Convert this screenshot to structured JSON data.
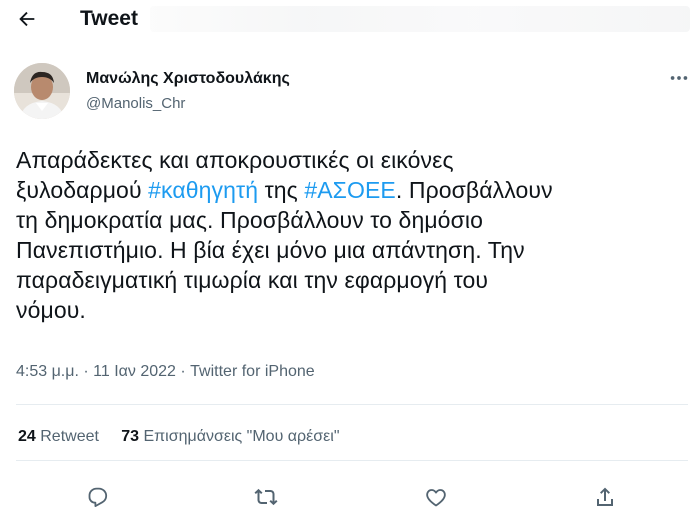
{
  "header": {
    "title": "Tweet",
    "back_icon": "arrow-left-icon"
  },
  "author": {
    "display_name": "Μανώλης Χριστοδουλάκης",
    "handle": "@Manolis_Chr"
  },
  "tweet": {
    "lines": [
      [
        {
          "text": "Απαράδεκτες και αποκρουστικές οι εικόνες"
        }
      ],
      [
        {
          "text": "ξυλοδαρμού "
        },
        {
          "text": "#καθηγητή",
          "hashtag": true
        },
        {
          "text": " της "
        },
        {
          "text": "#ΑΣΟΕΕ",
          "hashtag": true
        },
        {
          "text": ". Προσβάλλουν"
        }
      ],
      [
        {
          "text": "τη δημοκρατία μας. Προσβάλλουν το δημόσιο"
        }
      ],
      [
        {
          "text": "Πανεπιστήμιο. Η βία έχει μόνο μια απάντηση. Την"
        }
      ],
      [
        {
          "text": "παραδειγματική τιμωρία και την εφαρμογή του"
        }
      ],
      [
        {
          "text": "νόμου."
        }
      ]
    ],
    "time": "4:53 μ.μ.",
    "date": "11 Ιαν 2022",
    "source": "Twitter for iPhone",
    "separator": " · "
  },
  "stats": {
    "retweets_count": "24",
    "retweets_label": "Retweet",
    "likes_count": "73",
    "likes_label": "Επισημάνσεις \"Μου αρέσει\""
  },
  "actions": [
    "reply-icon",
    "retweet-icon",
    "like-icon",
    "share-icon"
  ],
  "colors": {
    "text": "#0f1419",
    "secondary": "#536471",
    "accent": "#1d9bf0",
    "divider": "#e6ecf0"
  }
}
